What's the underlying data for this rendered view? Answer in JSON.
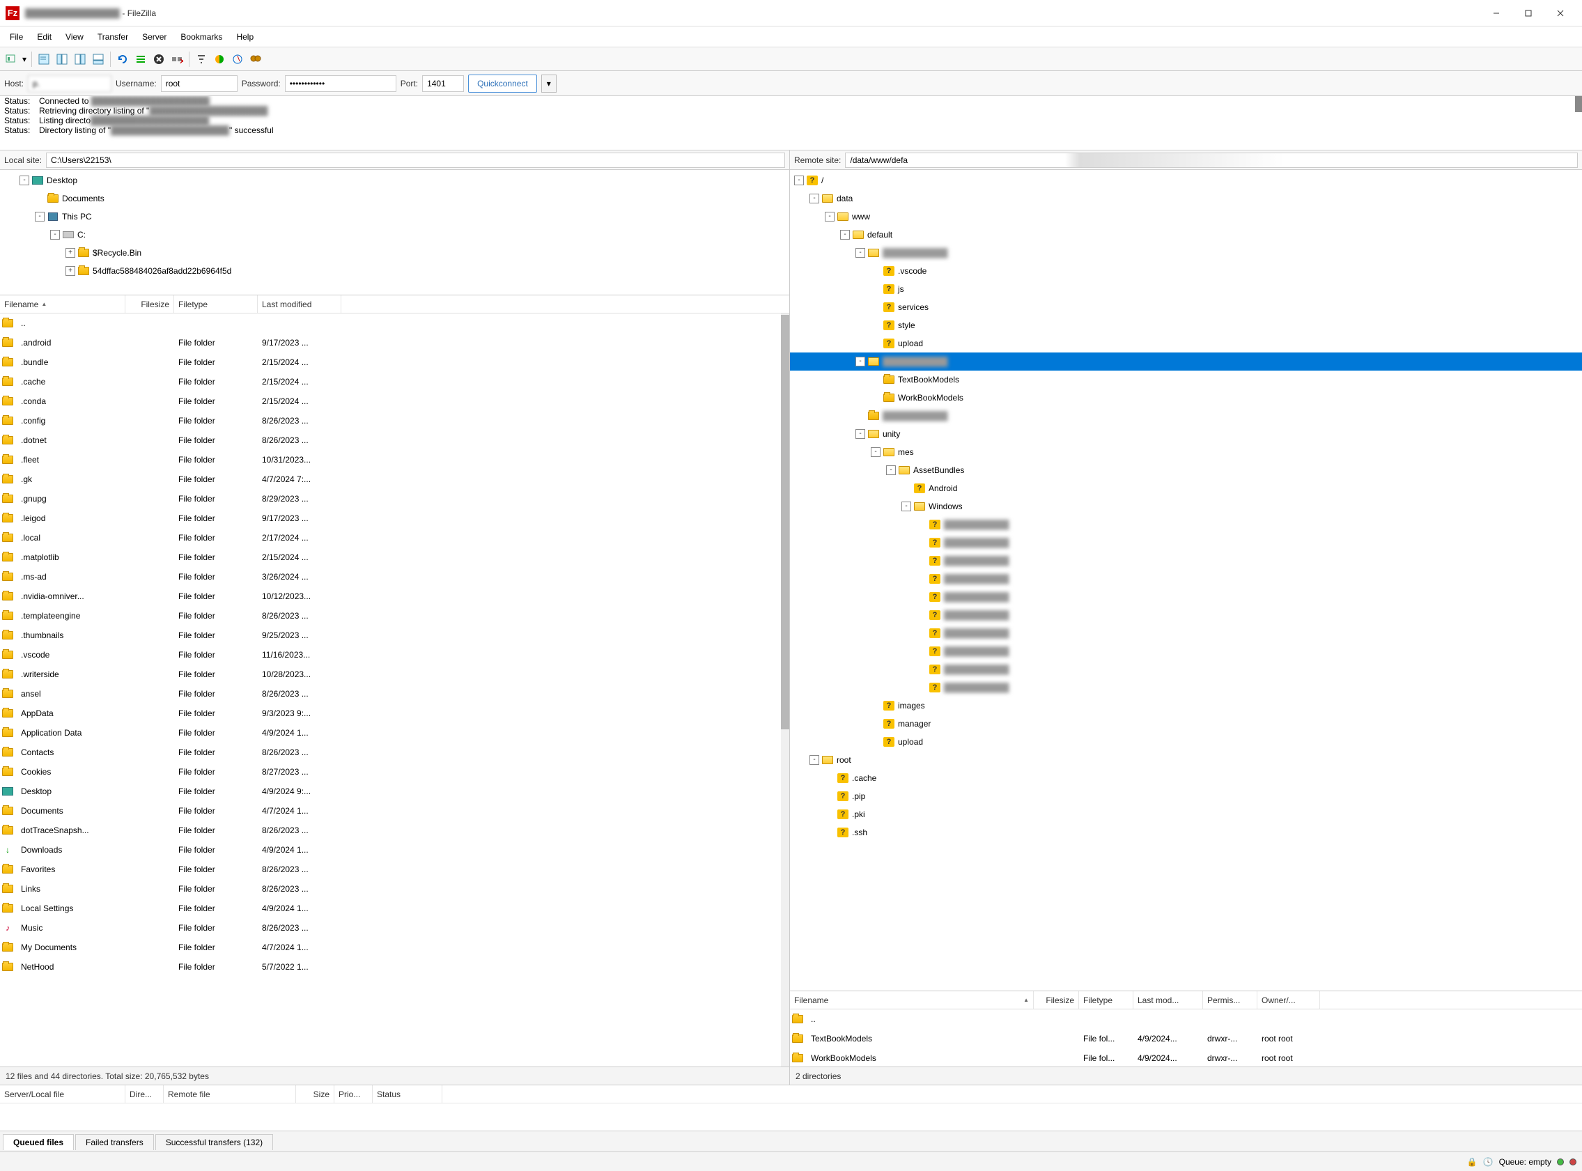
{
  "window": {
    "title": " - FileZilla"
  },
  "menu": {
    "file": "File",
    "edit": "Edit",
    "view": "View",
    "transfer": "Transfer",
    "server": "Server",
    "bookmarks": "Bookmarks",
    "help": "Help"
  },
  "quickconnect": {
    "host_label": "Host:",
    "host_value": "p.",
    "user_label": "Username:",
    "user_value": "root",
    "pass_label": "Password:",
    "pass_value": "••••••••••••",
    "port_label": "Port:",
    "port_value": "1401",
    "button": "Quickconnect"
  },
  "log": [
    {
      "s": "Status:",
      "m": "Connected to "
    },
    {
      "s": "Status:",
      "m": "Retrieving directory listing of \""
    },
    {
      "s": "Status:",
      "m": "Listing directo"
    },
    {
      "s": "Status:",
      "m": "Directory listing of \"",
      "suffix": "\" successful"
    }
  ],
  "local": {
    "label": "Local site:",
    "path": "C:\\Users\\22153\\",
    "tree": [
      {
        "indent": 1,
        "exp": "-",
        "icon": "desktop",
        "name": "Desktop"
      },
      {
        "indent": 2,
        "exp": " ",
        "icon": "folder",
        "name": "Documents"
      },
      {
        "indent": 2,
        "exp": "-",
        "icon": "pc",
        "name": "This PC"
      },
      {
        "indent": 3,
        "exp": "-",
        "icon": "drive",
        "name": "C:"
      },
      {
        "indent": 4,
        "exp": "+",
        "icon": "folder",
        "name": "$Recycle.Bin"
      },
      {
        "indent": 4,
        "exp": "+",
        "icon": "folder",
        "name": "54dffac588484026af8add22b6964f5d"
      }
    ],
    "cols": {
      "filename": "Filename",
      "filesize": "Filesize",
      "filetype": "Filetype",
      "lastmod": "Last modified"
    },
    "files": [
      {
        "n": "..",
        "s": "",
        "t": "",
        "m": "",
        "icon": "folder"
      },
      {
        "n": ".android",
        "s": "",
        "t": "File folder",
        "m": "9/17/2023 ..."
      },
      {
        "n": ".bundle",
        "s": "",
        "t": "File folder",
        "m": "2/15/2024 ..."
      },
      {
        "n": ".cache",
        "s": "",
        "t": "File folder",
        "m": "2/15/2024 ..."
      },
      {
        "n": ".conda",
        "s": "",
        "t": "File folder",
        "m": "2/15/2024 ..."
      },
      {
        "n": ".config",
        "s": "",
        "t": "File folder",
        "m": "8/26/2023 ..."
      },
      {
        "n": ".dotnet",
        "s": "",
        "t": "File folder",
        "m": "8/26/2023 ..."
      },
      {
        "n": ".fleet",
        "s": "",
        "t": "File folder",
        "m": "10/31/2023..."
      },
      {
        "n": ".gk",
        "s": "",
        "t": "File folder",
        "m": "4/7/2024 7:..."
      },
      {
        "n": ".gnupg",
        "s": "",
        "t": "File folder",
        "m": "8/29/2023 ..."
      },
      {
        "n": ".leigod",
        "s": "",
        "t": "File folder",
        "m": "9/17/2023 ..."
      },
      {
        "n": ".local",
        "s": "",
        "t": "File folder",
        "m": "2/17/2024 ..."
      },
      {
        "n": ".matplotlib",
        "s": "",
        "t": "File folder",
        "m": "2/15/2024 ..."
      },
      {
        "n": ".ms-ad",
        "s": "",
        "t": "File folder",
        "m": "3/26/2024 ..."
      },
      {
        "n": ".nvidia-omniver...",
        "s": "",
        "t": "File folder",
        "m": "10/12/2023..."
      },
      {
        "n": ".templateengine",
        "s": "",
        "t": "File folder",
        "m": "8/26/2023 ..."
      },
      {
        "n": ".thumbnails",
        "s": "",
        "t": "File folder",
        "m": "9/25/2023 ..."
      },
      {
        "n": ".vscode",
        "s": "",
        "t": "File folder",
        "m": "11/16/2023..."
      },
      {
        "n": ".writerside",
        "s": "",
        "t": "File folder",
        "m": "10/28/2023..."
      },
      {
        "n": "ansel",
        "s": "",
        "t": "File folder",
        "m": "8/26/2023 ..."
      },
      {
        "n": "AppData",
        "s": "",
        "t": "File folder",
        "m": "9/3/2023 9:..."
      },
      {
        "n": "Application Data",
        "s": "",
        "t": "File folder",
        "m": "4/9/2024 1..."
      },
      {
        "n": "Contacts",
        "s": "",
        "t": "File folder",
        "m": "8/26/2023 ..."
      },
      {
        "n": "Cookies",
        "s": "",
        "t": "File folder",
        "m": "8/27/2023 ..."
      },
      {
        "n": "Desktop",
        "s": "",
        "t": "File folder",
        "m": "4/9/2024 9:...",
        "icon": "desktop"
      },
      {
        "n": "Documents",
        "s": "",
        "t": "File folder",
        "m": "4/7/2024 1..."
      },
      {
        "n": "dotTraceSnapsh...",
        "s": "",
        "t": "File folder",
        "m": "8/26/2023 ..."
      },
      {
        "n": "Downloads",
        "s": "",
        "t": "File folder",
        "m": "4/9/2024 1...",
        "icon": "download"
      },
      {
        "n": "Favorites",
        "s": "",
        "t": "File folder",
        "m": "8/26/2023 ..."
      },
      {
        "n": "Links",
        "s": "",
        "t": "File folder",
        "m": "8/26/2023 ..."
      },
      {
        "n": "Local Settings",
        "s": "",
        "t": "File folder",
        "m": "4/9/2024 1..."
      },
      {
        "n": "Music",
        "s": "",
        "t": "File folder",
        "m": "8/26/2023 ...",
        "icon": "music"
      },
      {
        "n": "My Documents",
        "s": "",
        "t": "File folder",
        "m": "4/7/2024 1..."
      },
      {
        "n": "NetHood",
        "s": "",
        "t": "File folder",
        "m": "5/7/2022 1..."
      }
    ],
    "status": "12 files and 44 directories. Total size: 20,765,532 bytes"
  },
  "remote": {
    "label": "Remote site:",
    "path": "/data/www/defa",
    "tree": [
      {
        "indent": 0,
        "exp": "-",
        "icon": "q",
        "name": "/"
      },
      {
        "indent": 1,
        "exp": "-",
        "icon": "folderopen",
        "name": "data"
      },
      {
        "indent": 2,
        "exp": "-",
        "icon": "folderopen",
        "name": "www"
      },
      {
        "indent": 3,
        "exp": "-",
        "icon": "folderopen",
        "name": "default"
      },
      {
        "indent": 4,
        "exp": "-",
        "icon": "folderopen",
        "name": "",
        "blur": true
      },
      {
        "indent": 5,
        "exp": " ",
        "icon": "q",
        "name": ".vscode"
      },
      {
        "indent": 5,
        "exp": " ",
        "icon": "q",
        "name": "js"
      },
      {
        "indent": 5,
        "exp": " ",
        "icon": "q",
        "name": "services"
      },
      {
        "indent": 5,
        "exp": " ",
        "icon": "q",
        "name": "style"
      },
      {
        "indent": 5,
        "exp": " ",
        "icon": "q",
        "name": "upload"
      },
      {
        "indent": 4,
        "exp": "-",
        "icon": "folderopen",
        "name": "",
        "blur": true,
        "selected": true
      },
      {
        "indent": 5,
        "exp": " ",
        "icon": "folder",
        "name": "TextBookModels"
      },
      {
        "indent": 5,
        "exp": " ",
        "icon": "folder",
        "name": "WorkBookModels"
      },
      {
        "indent": 4,
        "exp": " ",
        "icon": "folder",
        "name": "",
        "blur": true
      },
      {
        "indent": 4,
        "exp": "-",
        "icon": "folderopen",
        "name": "unity"
      },
      {
        "indent": 5,
        "exp": "-",
        "icon": "folderopen",
        "name": "mes"
      },
      {
        "indent": 6,
        "exp": "-",
        "icon": "folderopen",
        "name": "AssetBundles"
      },
      {
        "indent": 7,
        "exp": " ",
        "icon": "q",
        "name": "Android"
      },
      {
        "indent": 7,
        "exp": "-",
        "icon": "folderopen",
        "name": "Windows"
      },
      {
        "indent": 8,
        "exp": " ",
        "icon": "q",
        "name": "",
        "blur": true
      },
      {
        "indent": 8,
        "exp": " ",
        "icon": "q",
        "name": "",
        "blur": true
      },
      {
        "indent": 8,
        "exp": " ",
        "icon": "q",
        "name": "",
        "blur": true
      },
      {
        "indent": 8,
        "exp": " ",
        "icon": "q",
        "name": "",
        "blur": true
      },
      {
        "indent": 8,
        "exp": " ",
        "icon": "q",
        "name": "",
        "blur": true
      },
      {
        "indent": 8,
        "exp": " ",
        "icon": "q",
        "name": "",
        "blur": true
      },
      {
        "indent": 8,
        "exp": " ",
        "icon": "q",
        "name": "",
        "blur": true
      },
      {
        "indent": 8,
        "exp": " ",
        "icon": "q",
        "name": "",
        "blur": true
      },
      {
        "indent": 8,
        "exp": " ",
        "icon": "q",
        "name": "",
        "blur": true
      },
      {
        "indent": 8,
        "exp": " ",
        "icon": "q",
        "name": "",
        "blur": true
      },
      {
        "indent": 5,
        "exp": " ",
        "icon": "q",
        "name": "images"
      },
      {
        "indent": 5,
        "exp": " ",
        "icon": "q",
        "name": "manager"
      },
      {
        "indent": 5,
        "exp": " ",
        "icon": "q",
        "name": "upload"
      },
      {
        "indent": 1,
        "exp": "-",
        "icon": "folderopen",
        "name": "root"
      },
      {
        "indent": 2,
        "exp": " ",
        "icon": "q",
        "name": ".cache"
      },
      {
        "indent": 2,
        "exp": " ",
        "icon": "q",
        "name": ".pip"
      },
      {
        "indent": 2,
        "exp": " ",
        "icon": "q",
        "name": ".pki"
      },
      {
        "indent": 2,
        "exp": " ",
        "icon": "q",
        "name": ".ssh"
      }
    ],
    "cols": {
      "filename": "Filename",
      "filesize": "Filesize",
      "filetype": "Filetype",
      "lastmod": "Last mod...",
      "perm": "Permis...",
      "owner": "Owner/..."
    },
    "files": [
      {
        "n": "..",
        "t": "",
        "m": "",
        "p": "",
        "o": ""
      },
      {
        "n": "TextBookModels",
        "t": "File fol...",
        "m": "4/9/2024...",
        "p": "drwxr-...",
        "o": "root root"
      },
      {
        "n": "WorkBookModels",
        "t": "File fol...",
        "m": "4/9/2024...",
        "p": "drwxr-...",
        "o": "root root"
      }
    ],
    "status": "2 directories"
  },
  "queue": {
    "cols": {
      "server": "Server/Local file",
      "dir": "Dire...",
      "remote": "Remote file",
      "size": "Size",
      "prio": "Prio...",
      "status": "Status"
    },
    "tabs": {
      "queued": "Queued files",
      "failed": "Failed transfers",
      "success": "Successful transfers (132)"
    }
  },
  "statusbar": {
    "queue": "Queue: empty"
  }
}
